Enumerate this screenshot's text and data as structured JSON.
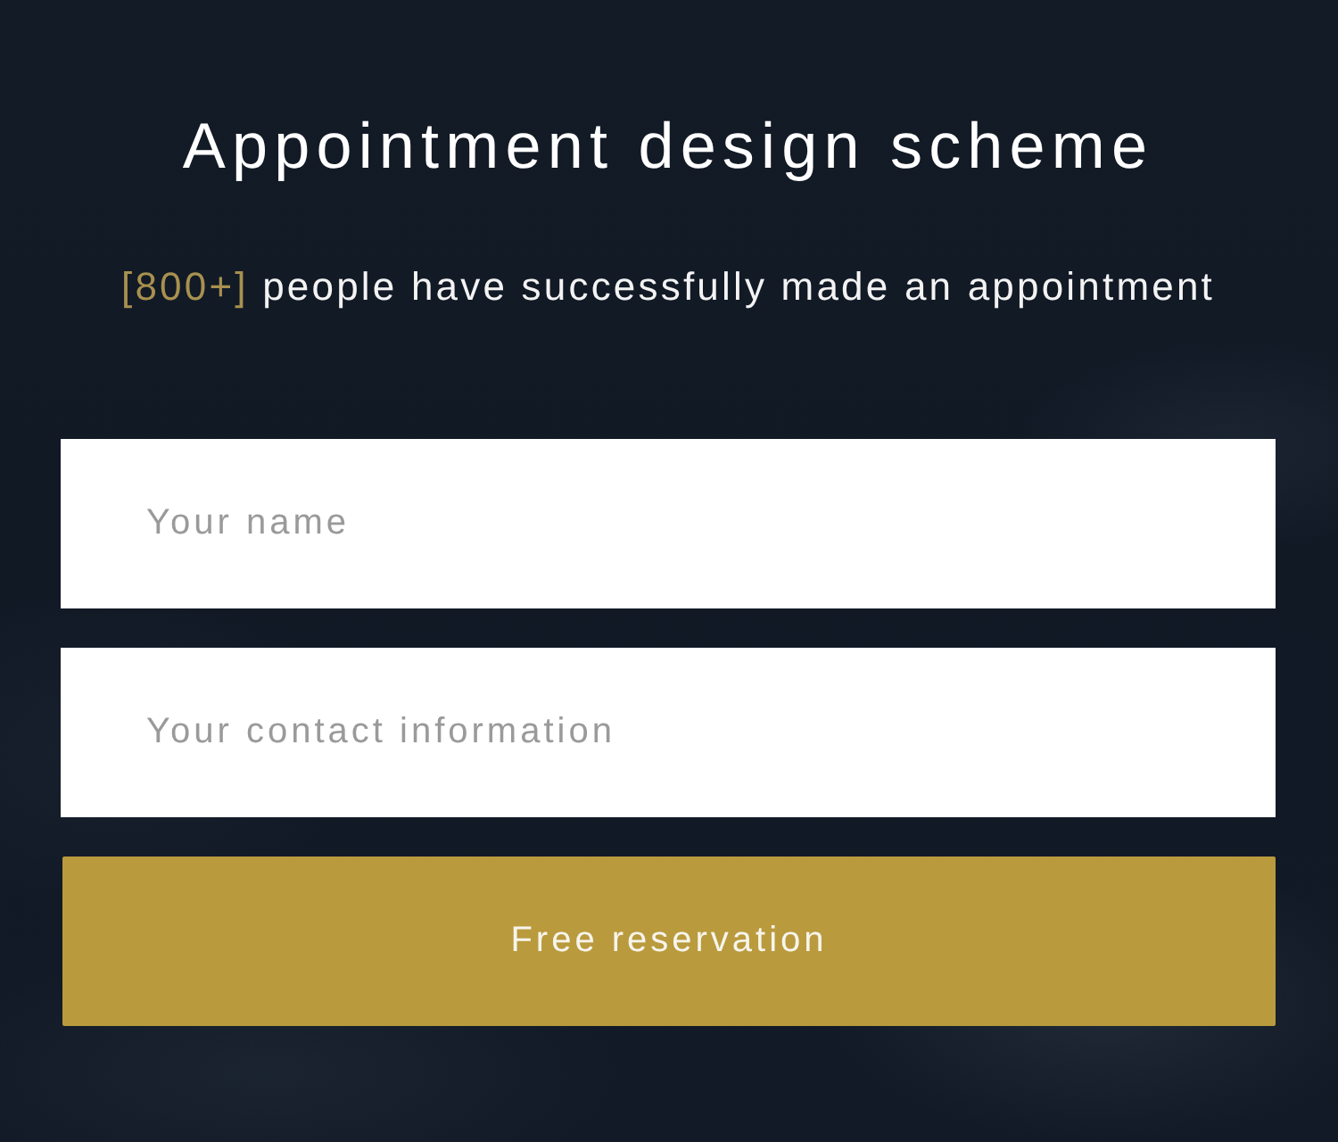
{
  "heading": {
    "title": "Appointment design scheme",
    "subtitle": {
      "count": "[800+]",
      "text": "people have successfully made an appointment"
    }
  },
  "fields": [
    {
      "placeholder": "Your name"
    },
    {
      "placeholder": "Your contact information"
    }
  ],
  "button": {
    "label": "Free reservation"
  }
}
